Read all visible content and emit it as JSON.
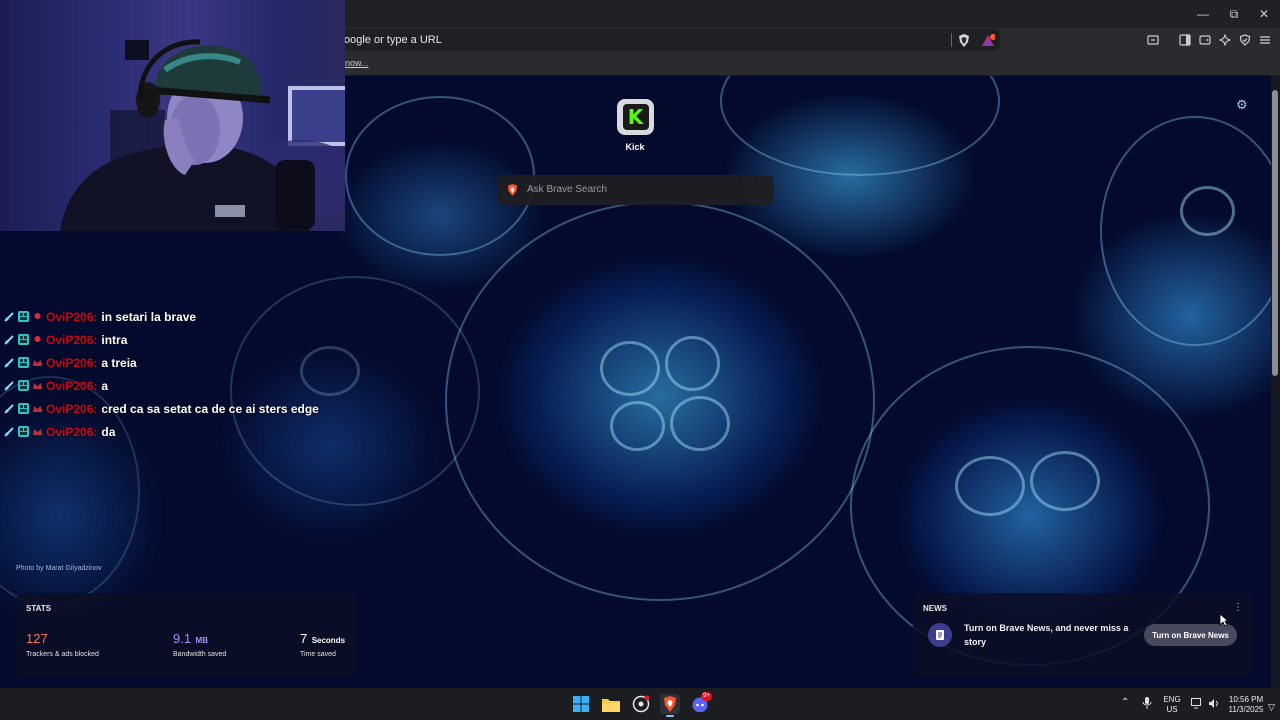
{
  "browser": {
    "url_placeholder": "oogle or type a URL",
    "bookmark_link": "now..."
  },
  "newtab": {
    "top_site_label": "Kick",
    "search_placeholder": "Ask Brave Search",
    "photo_credit": "Photo by Marat Gilyadzinov"
  },
  "chat": [
    {
      "user": "OviP206",
      "message": "in setari la brave"
    },
    {
      "user": "OviP206",
      "message": "intra"
    },
    {
      "user": "OviP206",
      "message": "a treia"
    },
    {
      "user": "OviP206",
      "message": "a"
    },
    {
      "user": "OviP206",
      "message": "cred ca sa setat ca de ce ai sters edge"
    },
    {
      "user": "OviP206",
      "message": "da"
    }
  ],
  "stats": {
    "title": "STATS",
    "trackers_value": "127",
    "trackers_label": "Trackers & ads blocked",
    "bandwidth_value": "9.1",
    "bandwidth_unit": "MB",
    "bandwidth_label": "Bandwidth saved",
    "time_value": "7",
    "time_unit": "Seconds",
    "time_label": "Time saved"
  },
  "news": {
    "title": "NEWS",
    "message": "Turn on Brave News, and never miss a story",
    "button": "Turn on Brave News"
  },
  "taskbar": {
    "lang": "ENG",
    "region": "US",
    "time": "10:56 PM",
    "date": "11/3/2025",
    "discord_badge": "9+"
  },
  "colors": {
    "trackers": "#ff6f61",
    "bandwidth": "#a390ff",
    "chat_user": "#d0021b",
    "kick_green": "#53fc18"
  }
}
